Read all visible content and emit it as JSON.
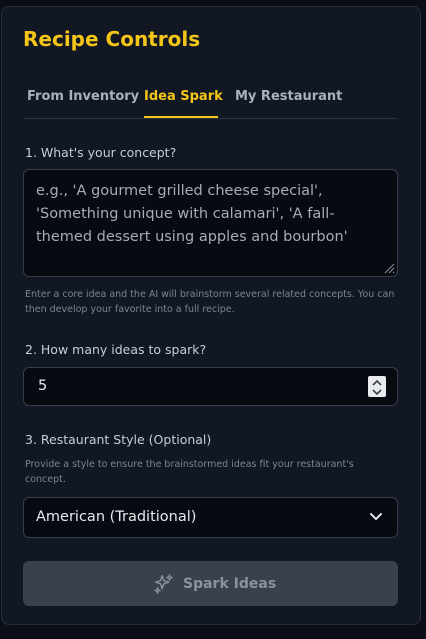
{
  "panel": {
    "title": "Recipe Controls"
  },
  "tabs": [
    {
      "label": "From Inventory",
      "active": false
    },
    {
      "label": "Idea Spark",
      "active": true
    },
    {
      "label": "My Restaurant",
      "active": false
    }
  ],
  "concept": {
    "label": "1. What's your concept?",
    "placeholder": "e.g., 'A gourmet grilled cheese special', 'Something unique with calamari', 'A fall-themed dessert using apples and bourbon'",
    "value": "",
    "hint": "Enter a core idea and the AI will brainstorm several related concepts. You can then develop your favorite into a full recipe."
  },
  "idea_count": {
    "label": "2. How many ideas to spark?",
    "value": "5"
  },
  "style": {
    "label": "3. Restaurant Style (Optional)",
    "hint": "Provide a style to ensure the brainstormed ideas fit your restaurant's concept.",
    "selected": "American (Traditional)"
  },
  "action": {
    "spark_label": "Spark Ideas",
    "icon": "sparkles-icon",
    "disabled": true
  },
  "colors": {
    "accent": "#f5c518",
    "panel_bg": "#111723",
    "page_bg": "#0a0e16",
    "input_bg": "#070a10",
    "button_disabled_bg": "#3a404c"
  }
}
